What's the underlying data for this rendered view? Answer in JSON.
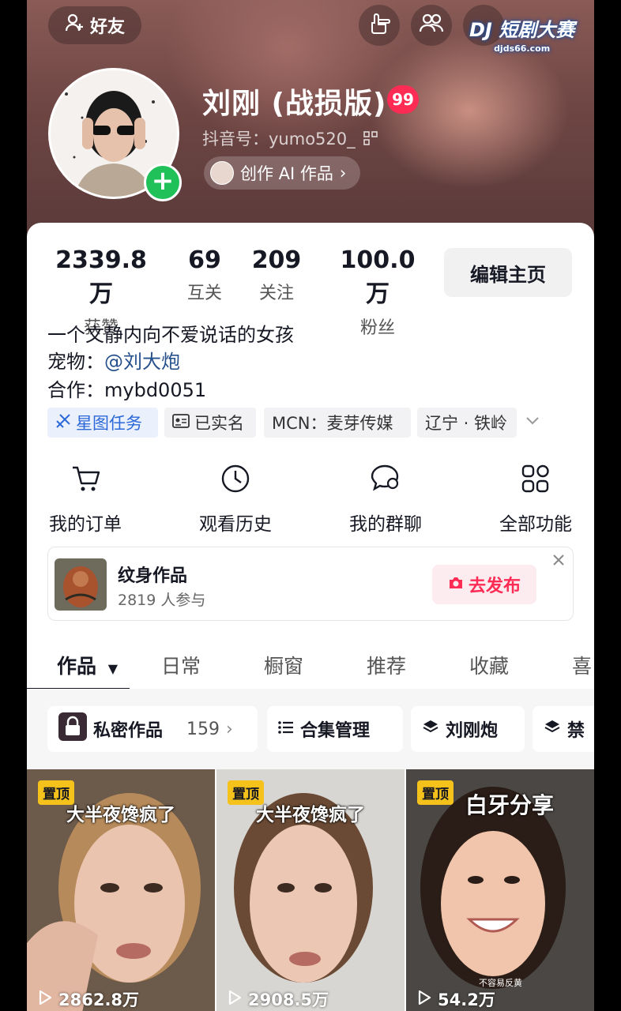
{
  "header": {
    "add_friend": "好友",
    "watermark_main": "短剧大赛",
    "watermark_sub": "djds66.com",
    "name": "刘刚 (战损版)",
    "badge": "99",
    "douyin_id": "抖音号：yumo520_",
    "create_ai": "创作 AI 作品"
  },
  "stats": [
    {
      "num": "2339.8万",
      "label": "获赞"
    },
    {
      "num": "69",
      "label": "互关"
    },
    {
      "num": "209",
      "label": "关注"
    },
    {
      "num": "100.0万",
      "label": "粉丝"
    }
  ],
  "edit_button": "编辑主页",
  "bio": {
    "line1": "一个文静内向不爱说话的女孩",
    "pet_prefix": "宠物：",
    "pet_link": "@刘大炮",
    "coop": "合作：mybd0051"
  },
  "tags": [
    "星图任务",
    "已实名",
    "MCN：麦芽传媒",
    "辽宁 · 铁岭"
  ],
  "functions": [
    "我的订单",
    "观看历史",
    "我的群聊",
    "全部功能"
  ],
  "tattoo": {
    "title": "纹身作品",
    "participants": "2819 人参与",
    "publish": "去发布"
  },
  "tabs": [
    "作品",
    "日常",
    "橱窗",
    "推荐",
    "收藏",
    "喜"
  ],
  "chips": {
    "private_label": "私密作品",
    "private_count": "159",
    "collection": "合集管理",
    "liu": "刘刚炮",
    "forbidden": "禁"
  },
  "videos": [
    {
      "pin": "置顶",
      "caption": "大半夜馋疯了",
      "plays": "2862.8万"
    },
    {
      "pin": "置顶",
      "caption": "大半夜馋疯了",
      "plays": "2908.5万"
    },
    {
      "pin": "置顶",
      "caption": "白牙分享",
      "plays": "54.2万",
      "small_note": "不容易反黄"
    }
  ]
}
